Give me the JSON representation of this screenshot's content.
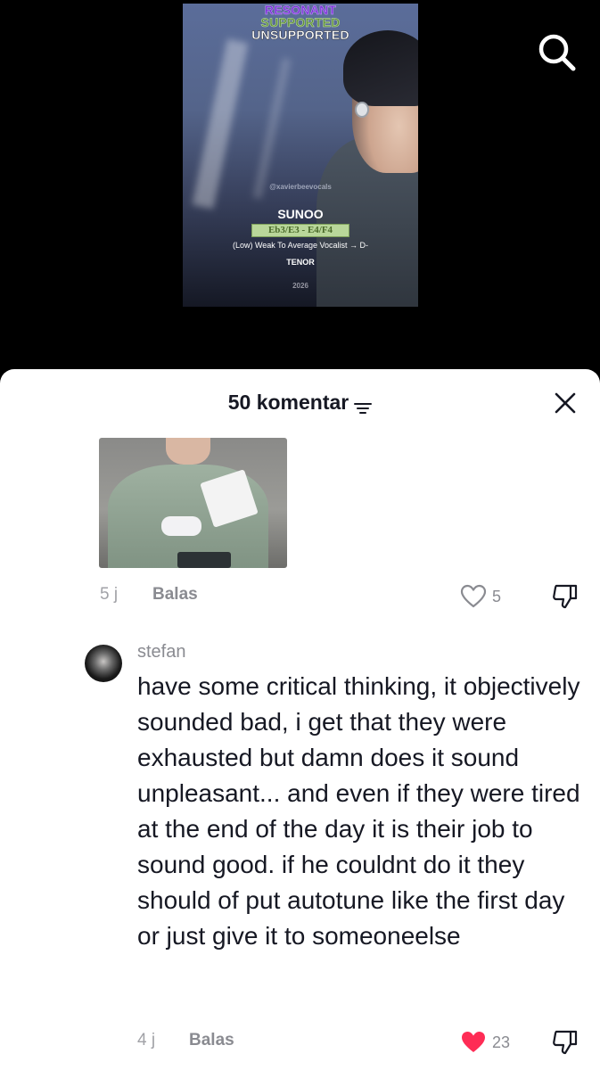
{
  "video": {
    "tag_resonant": "RESONANT",
    "tag_supported": "SUPPORTED",
    "tag_unsupported": "UNSUPPORTED",
    "watermark": "@xavierbeevocals",
    "singer_name": "SUNOO",
    "vocal_range": "Eb3/E3 - E4/F4",
    "description": "(Low) Weak To Average Vocalist → D-",
    "voice_type": "TENOR",
    "year": "2026"
  },
  "top_bar": {
    "search_icon": "search-icon"
  },
  "sheet": {
    "title": "50 komentar",
    "sort_icon": "sort-filter-icon",
    "close_icon": "close-icon"
  },
  "comments": [
    {
      "has_image": true,
      "time": "5 j",
      "reply_label": "Balas",
      "likes": "5",
      "liked": false
    },
    {
      "username": "stefan",
      "text": "have some critical thinking, it objectively sounded bad, i get that they were exhausted but damn does it sound unpleasant... and even if they were tired at the end of the day it is their job to sound good. if he couldnt do it they should of put autotune like the first day or just give it to someoneelse",
      "time": "4 j",
      "reply_label": "Balas",
      "likes": "23",
      "liked": true,
      "like_color": "#fe2c55"
    }
  ]
}
